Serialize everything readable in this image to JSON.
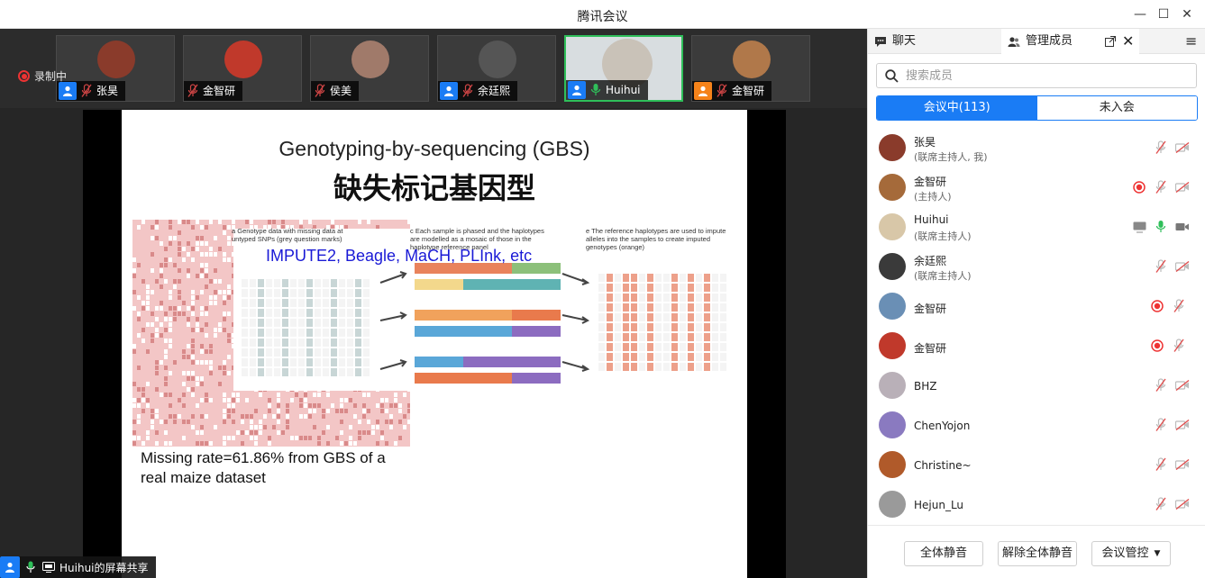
{
  "window": {
    "title": "腾讯会议"
  },
  "recording": {
    "label": "录制中"
  },
  "thumbnails": [
    {
      "name": "张昊",
      "avatar_color": "#8a3b2b",
      "badge": true,
      "badge_color": "#1a7cf5",
      "mic": "muted"
    },
    {
      "name": "金智研",
      "avatar_color": "#c0392b",
      "badge": false,
      "mic": "muted"
    },
    {
      "name": "侯美",
      "avatar_color": "#a07a6a",
      "badge": false,
      "mic": "muted"
    },
    {
      "name": "余廷熙",
      "avatar_color": "#555555",
      "badge": true,
      "badge_color": "#1a7cf5",
      "mic": "muted"
    },
    {
      "name": "Huihui",
      "avatar_color": "#c9c2b8",
      "badge": true,
      "badge_color": "#1a7cf5",
      "mic": "on",
      "active": true
    },
    {
      "name": "金智研",
      "avatar_color": "#b0784a",
      "badge": true,
      "badge_color": "#f5831a",
      "mic": "muted"
    }
  ],
  "slide": {
    "title": "Genotyping-by-sequencing (GBS)",
    "title_cn": "缺失标记基因型",
    "tools": "IMPUTE2, Beagle, MaCH, PLInk, etc",
    "missing_text": "Missing rate=61.86% from GBS of a real maize dataset",
    "panel_a": "a  Genotype data with missing data at untyped SNPs (grey question marks)",
    "panel_c": "c  Each sample is phased and the haplotypes are modelled as a mosaic of those in the haplotype reference panel",
    "panel_e": "e  The reference haplotypes are used to impute alleles into the samples to create imputed genotypes (orange)"
  },
  "screen_share": {
    "label": "Huihui的屏幕共享"
  },
  "side_panel": {
    "tab_chat": "聊天",
    "tab_members": "管理成员",
    "search_placeholder": "搜索成员",
    "seg_in": "会议中(113)",
    "seg_out": "未入会",
    "members": [
      {
        "name": "张昊",
        "role": "(联席主持人, 我)",
        "avatar_color": "#8a3b2b",
        "rec": false,
        "screen": false,
        "mic": "muted",
        "cam": "off"
      },
      {
        "name": "金智研",
        "role": "(主持人)",
        "avatar_color": "#a56a3a",
        "rec": true,
        "screen": false,
        "mic": "muted",
        "cam": "off"
      },
      {
        "name": "Huihui",
        "role": "(联席主持人)",
        "avatar_color": "#d8c7a8",
        "rec": false,
        "screen": true,
        "mic": "on",
        "cam": "on"
      },
      {
        "name": "余廷熙",
        "role": "(联席主持人)",
        "avatar_color": "#3a3a3a",
        "rec": false,
        "screen": false,
        "mic": "muted",
        "cam": "off"
      },
      {
        "name": "金智研",
        "role": "",
        "avatar_color": "#6a8fb5",
        "rec": true,
        "screen": false,
        "mic": "muted",
        "cam": "none"
      },
      {
        "name": "金智研",
        "role": "",
        "avatar_color": "#c0392b",
        "rec": true,
        "screen": false,
        "mic": "muted",
        "cam": "none"
      },
      {
        "name": "BHZ",
        "role": "",
        "avatar_color": "#b9b0b8",
        "rec": false,
        "screen": false,
        "mic": "muted",
        "cam": "off"
      },
      {
        "name": "ChenYojon",
        "role": "",
        "avatar_color": "#8a7ac0",
        "rec": false,
        "screen": false,
        "mic": "muted",
        "cam": "off"
      },
      {
        "name": "Christine~",
        "role": "",
        "avatar_color": "#b05a2a",
        "rec": false,
        "screen": false,
        "mic": "muted",
        "cam": "off"
      },
      {
        "name": "Hejun_Lu",
        "role": "",
        "avatar_color": "#9a9a9a",
        "rec": false,
        "screen": false,
        "mic": "muted",
        "cam": "off"
      }
    ],
    "footer": {
      "mute_all": "全体静音",
      "unmute_all": "解除全体静音",
      "control": "会议管控"
    }
  }
}
